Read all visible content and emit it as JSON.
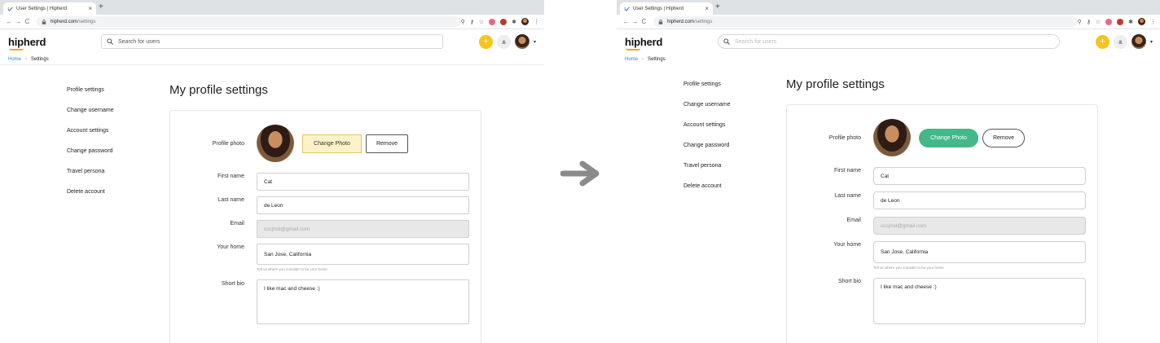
{
  "browser": {
    "tab_title": "User Settings | Hipherd",
    "tab_close": "×",
    "new_tab": "+",
    "url_host": "hipherd.com",
    "url_path": "/settings",
    "nav_back": "←",
    "nav_forward": "→",
    "nav_reload": "C"
  },
  "header": {
    "logo": "hipherd",
    "search_placeholder": "Search for users",
    "plus": "+",
    "caret": "▾"
  },
  "breadcrumb": {
    "home": "Home",
    "separator": "›",
    "current": "Settings"
  },
  "sidebar": {
    "items": [
      {
        "label": "Profile settings"
      },
      {
        "label": "Change username"
      },
      {
        "label": "Account settings"
      },
      {
        "label": "Change password"
      },
      {
        "label": "Travel persona"
      },
      {
        "label": "Delete account"
      }
    ]
  },
  "main": {
    "title": "My profile settings",
    "photo_label": "Profile photo",
    "change_photo": "Change Photo",
    "remove": "Remove",
    "first_name_label": "First name",
    "first_name_value": "Cat",
    "last_name_label": "Last name",
    "last_name_value": "de Leon",
    "email_label": "Email",
    "email_value": "cccjmd@gmail.com",
    "home_label": "Your home",
    "home_value": "San Jose, California",
    "home_help": "Tell us where you consider to be your home",
    "bio_label": "Short bio",
    "bio_value": "I like mac and cheese :)"
  },
  "colors": {
    "accent_yellow": "#f7c41f",
    "change_photo_before": "#fdf2c7",
    "change_photo_after": "#43b88a",
    "link_blue": "#2f86d6",
    "arrow_gray": "#8a8a8a"
  }
}
